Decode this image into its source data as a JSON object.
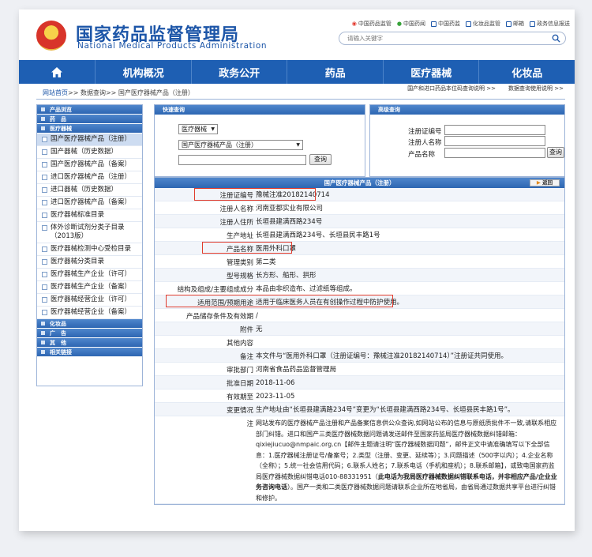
{
  "header": {
    "title": "国家药品监督管理局",
    "subtitle": "National Medical Products Administration",
    "top_links": [
      "中国药品监管",
      "中国药闻",
      "中国药监",
      "化妆品监管",
      "邮箱",
      "政务信息报送"
    ],
    "search_placeholder": "请输入关键字"
  },
  "nav": [
    "机构概况",
    "政务公开",
    "药品",
    "医疗器械",
    "化妆品"
  ],
  "breadcrumb": {
    "home": "网站首页",
    "sep": ">>",
    "data": "数据查询",
    "current": "国产医疗器械产品（注册）"
  },
  "right_links": [
    "国产和进口药品本位码查询说明 >>",
    "数据查询使用说明 >>"
  ],
  "sidebar": {
    "heads": [
      "产品浏览",
      "药　品",
      "医疗器械",
      "化妆品",
      "广　告",
      "其　他",
      "相关链接"
    ],
    "device_items": [
      "国产医疗器械产品（注册）",
      "国产器械（历史数据）",
      "国产医疗器械产品（备案）",
      "进口医疗器械产品（注册）",
      "进口器械（历史数据）",
      "进口医疗器械产品（备案）",
      "医疗器械标准目录",
      "体外诊断试剂分类子目录（2013版）",
      "医疗器械检测中心受检目录",
      "医疗器械分类目录",
      "医疗器械生产企业（许可）",
      "医疗器械生产企业（备案）",
      "医疗器械经营企业（许可）",
      "医疗器械经营企业（备案）"
    ]
  },
  "quick_query": {
    "title": "快速查询",
    "select1": "医疗器械",
    "select2": "国产医疗器械产品（注册）",
    "button": "查询"
  },
  "advanced_query": {
    "title": "高级查询",
    "labels": [
      "注册证编号",
      "注册人名称",
      "产品名称"
    ],
    "button": "查询"
  },
  "detail": {
    "title": "国产医疗器械产品（注册）",
    "back": "返回",
    "rows": [
      {
        "key": "注册证编号",
        "value": "豫械注准20182140714"
      },
      {
        "key": "注册人名称",
        "value": "河南亚都实业有限公司"
      },
      {
        "key": "注册人住所",
        "value": "长垣县建满西路234号"
      },
      {
        "key": "生产地址",
        "value": "长垣县建满西路234号、长垣县民丰路1号"
      },
      {
        "key": "产品名称",
        "value": "医用外科口罩"
      },
      {
        "key": "管理类别",
        "value": "第二类"
      },
      {
        "key": "型号规格",
        "value": "长方形、船形、拱形"
      },
      {
        "key": "结构及组成/主要组成成分",
        "value": "本品由非织造布、过滤纸等组成。"
      },
      {
        "key": "适用范围/预期用途",
        "value": "适用于临床医务人员在有创操作过程中防护使用。"
      },
      {
        "key": "产品储存条件及有效期",
        "value": "/"
      },
      {
        "key": "附件",
        "value": "无"
      },
      {
        "key": "其他内容",
        "value": ""
      },
      {
        "key": "备注",
        "value": "本文件与“医用外科口罩（注册证编号：豫械注准20182140714）”注册证共同使用。"
      },
      {
        "key": "审批部门",
        "value": "河南省食品药品监督管理局"
      },
      {
        "key": "批准日期",
        "value": "2018-11-06"
      },
      {
        "key": "有效期至",
        "value": "2023-11-05"
      },
      {
        "key": "变更情况",
        "value": "生产地址由“长垣县建满路234号”变更为“长垣县建满西路234号、长垣县民丰路1号”。"
      }
    ],
    "note_key": "注",
    "note_a": "网站发布的医疗器械产品注册和产品备案信息供公众查询,如网站公布的信息与原纸质批件不一致,请联系相应部门纠错。进口和国产三类医疗器械数据问题请发送邮件至国家药监局医疗器械数据纠错邮箱：qixiejiucuo@nmpaic.org.cn【邮件主题请注明“医疗器械数据问题”，邮件正文中请准确填写以下全部信息：1.医疗器械注册证号/备案号；2.类型（注册、变更、延续等）；3.问题描述（500字以内）；4.企业名称（全称）；5.统一社会信用代码；6.联系人姓名；7.联系电话（手机和座机）；8.联系邮箱】，或致电国家药监局医疗器械数据纠错电话010-88331951（",
    "note_bold": "此电话为我局医疗器械数据纠错联系电话，并非相应产品/企业业务咨询电话",
    "note_b": "）。国产一类和二类医疗器械数据问题请联系企业所在地省局，由省局通过数据共享平台进行纠错和修护。"
  }
}
